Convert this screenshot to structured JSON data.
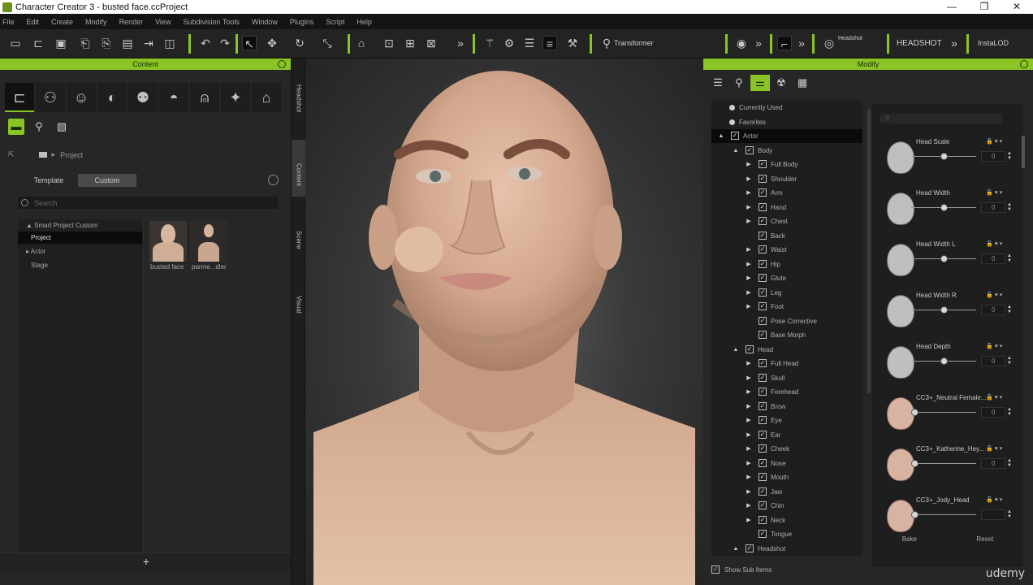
{
  "window": {
    "title": "Character Creator 3 - busted face.ccProject",
    "controls": [
      "—",
      "❐",
      "✕"
    ]
  },
  "menu": [
    "File",
    "Edit",
    "Create",
    "Modify",
    "Render",
    "View",
    "Subdivision Tools",
    "Window",
    "Plugins",
    "Script",
    "Help"
  ],
  "toolbar": {
    "transformer": "Transformer",
    "headshot": "HEADSHOT",
    "headshot_small": "Headshot",
    "instalod": "InstaLOD"
  },
  "content_panel": {
    "header": "Content",
    "path_label": "Project",
    "tabs": [
      "Template",
      "Custom"
    ],
    "search_placeholder": "Search",
    "tree": [
      {
        "label": "Smart Project Custom",
        "prefix": "▲"
      },
      {
        "label": "Project",
        "selected": true
      },
      {
        "label": "Actor",
        "prefix": "▸"
      },
      {
        "label": "Stage"
      }
    ],
    "thumbnails": [
      "busted face",
      "parme...dler"
    ],
    "add_label": "+"
  },
  "side_tabs": [
    "Headshot",
    "Content",
    "Scene",
    "Visual"
  ],
  "modify_panel": {
    "header": "Modify",
    "tree": [
      {
        "label": "Currently Used",
        "level": 0,
        "bullet": true
      },
      {
        "label": "Favorites",
        "level": 0,
        "bullet": true
      },
      {
        "label": "Actor",
        "level": 0,
        "expand": "▲",
        "check": true,
        "highlight": true
      },
      {
        "label": "Body",
        "level": 1,
        "expand": "▲",
        "check": true
      },
      {
        "label": "Full Body",
        "level": 2,
        "expand": "▶",
        "check": true
      },
      {
        "label": "Shoulder",
        "level": 2,
        "expand": "▶",
        "check": true
      },
      {
        "label": "Arm",
        "level": 2,
        "expand": "▶",
        "check": true
      },
      {
        "label": "Hand",
        "level": 2,
        "expand": "▶",
        "check": true
      },
      {
        "label": "Chest",
        "level": 2,
        "expand": "▶",
        "check": true
      },
      {
        "label": "Back",
        "level": 2,
        "expand": "",
        "check": true
      },
      {
        "label": "Waist",
        "level": 2,
        "expand": "▶",
        "check": true
      },
      {
        "label": "Hip",
        "level": 2,
        "expand": "▶",
        "check": true
      },
      {
        "label": "Glute",
        "level": 2,
        "expand": "▶",
        "check": true
      },
      {
        "label": "Leg",
        "level": 2,
        "expand": "▶",
        "check": true
      },
      {
        "label": "Foot",
        "level": 2,
        "expand": "▶",
        "check": true
      },
      {
        "label": "Pose Corrective",
        "level": 2,
        "expand": "",
        "check": true
      },
      {
        "label": "Base Morph",
        "level": 2,
        "expand": "",
        "check": true
      },
      {
        "label": "Head",
        "level": 1,
        "expand": "▲",
        "check": true
      },
      {
        "label": "Full Head",
        "level": 2,
        "expand": "▶",
        "check": true
      },
      {
        "label": "Skull",
        "level": 2,
        "expand": "▶",
        "check": true
      },
      {
        "label": "Forehead",
        "level": 2,
        "expand": "▶",
        "check": true
      },
      {
        "label": "Brow",
        "level": 2,
        "expand": "▶",
        "check": true
      },
      {
        "label": "Eye",
        "level": 2,
        "expand": "▶",
        "check": true
      },
      {
        "label": "Ear",
        "level": 2,
        "expand": "▶",
        "check": true
      },
      {
        "label": "Cheek",
        "level": 2,
        "expand": "▶",
        "check": true
      },
      {
        "label": "Nose",
        "level": 2,
        "expand": "▶",
        "check": true
      },
      {
        "label": "Mouth",
        "level": 2,
        "expand": "▶",
        "check": true
      },
      {
        "label": "Jaw",
        "level": 2,
        "expand": "▶",
        "check": true
      },
      {
        "label": "Chin",
        "level": 2,
        "expand": "▶",
        "check": true
      },
      {
        "label": "Neck",
        "level": 2,
        "expand": "▶",
        "check": true
      },
      {
        "label": "Tongue",
        "level": 2,
        "expand": "",
        "check": true
      },
      {
        "label": "Headshot",
        "level": 1,
        "expand": "▲",
        "check": true
      }
    ],
    "morphs": [
      {
        "name": "Head Scale",
        "value": "0",
        "slider": 0.5,
        "face": false
      },
      {
        "name": "Head Width",
        "value": "0",
        "slider": 0.5,
        "face": false
      },
      {
        "name": "Head Width L",
        "value": "0",
        "slider": 0.5,
        "face": false
      },
      {
        "name": "Head Width R",
        "value": "0",
        "slider": 0.5,
        "face": false
      },
      {
        "name": "Head Depth",
        "value": "0",
        "slider": 0.5,
        "face": false
      },
      {
        "name": "CC3+_Neutral Female...",
        "value": "0",
        "slider": 0.0,
        "face": true
      },
      {
        "name": "CC3+_Katherine_Hey...",
        "value": "0",
        "slider": 0.0,
        "face": true
      },
      {
        "name": "CC3+_Jody_Head",
        "value": "",
        "slider": 0.0,
        "face": true
      }
    ],
    "bake": "Bake",
    "reset": "Reset",
    "show_sub_items": "Show Sub Items"
  },
  "watermark": "udemy",
  "colors": {
    "accent": "#8ac425"
  }
}
